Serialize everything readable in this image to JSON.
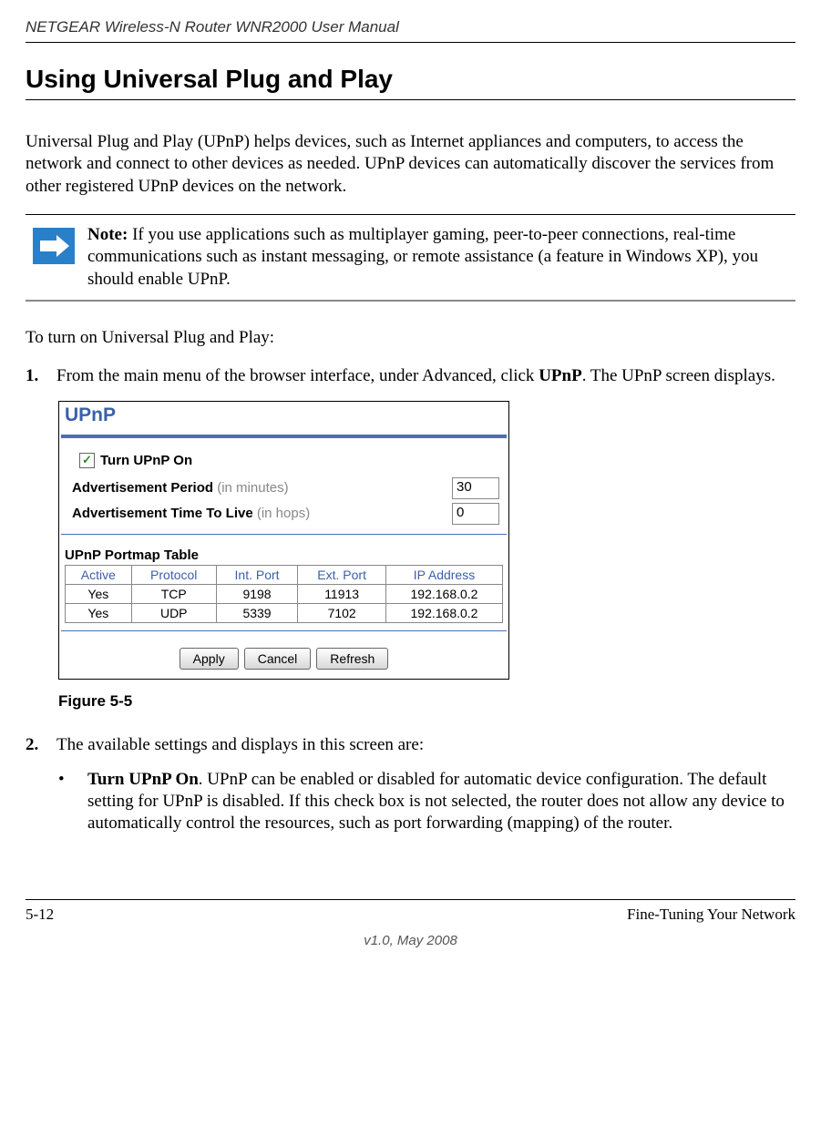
{
  "header": {
    "doc_title": "NETGEAR Wireless-N Router WNR2000 User Manual"
  },
  "section": {
    "heading": "Using Universal Plug and Play",
    "intro": "Universal Plug and Play (UPnP) helps devices, such as Internet appliances and computers, to access the network and connect to other devices as needed. UPnP devices can automatically discover the services from other registered UPnP devices on the network."
  },
  "note": {
    "label": "Note:",
    "text": " If you use applications such as multiplayer gaming, peer-to-peer connections, real-time communications such as instant messaging, or remote assistance (a feature in Windows XP), you should enable UPnP."
  },
  "steps": {
    "lead": "To turn on Universal Plug and Play:",
    "s1_num": "1.",
    "s1_a": "From the main menu of the browser interface, under Advanced, click ",
    "s1_b": "UPnP",
    "s1_c": ". The UPnP screen displays.",
    "s2_num": "2.",
    "s2_text": "The available settings and displays in this screen are:",
    "sub_bullet": "•",
    "sub_a": "Turn UPnP On",
    "sub_b": ". UPnP can be enabled or disabled for automatic device configuration. The default setting for UPnP is disabled. If this check box is not selected, the router does not allow any device to automatically control the resources, such as port forwarding (mapping) of the router."
  },
  "upnp_panel": {
    "title": "UPnP",
    "turn_on": "Turn UPnP On",
    "adv_period_label": "Advertisement Period",
    "adv_period_suffix": " (in minutes)",
    "adv_period_value": "30",
    "adv_ttl_label": "Advertisement Time To Live",
    "adv_ttl_suffix": " (in hops)",
    "adv_ttl_value": "0",
    "portmap_label": "UPnP Portmap Table",
    "headers": {
      "active": "Active",
      "protocol": "Protocol",
      "intport": "Int. Port",
      "extport": "Ext. Port",
      "ip": "IP Address"
    },
    "rows": [
      {
        "active": "Yes",
        "protocol": "TCP",
        "int": "9198",
        "ext": "11913",
        "ip": "192.168.0.2"
      },
      {
        "active": "Yes",
        "protocol": "UDP",
        "int": "5339",
        "ext": "7102",
        "ip": "192.168.0.2"
      }
    ],
    "buttons": {
      "apply": "Apply",
      "cancel": "Cancel",
      "refresh": "Refresh"
    }
  },
  "figure_caption": "Figure 5-5",
  "footer": {
    "page": "5-12",
    "section": "Fine-Tuning Your Network",
    "version": "v1.0, May 2008"
  }
}
